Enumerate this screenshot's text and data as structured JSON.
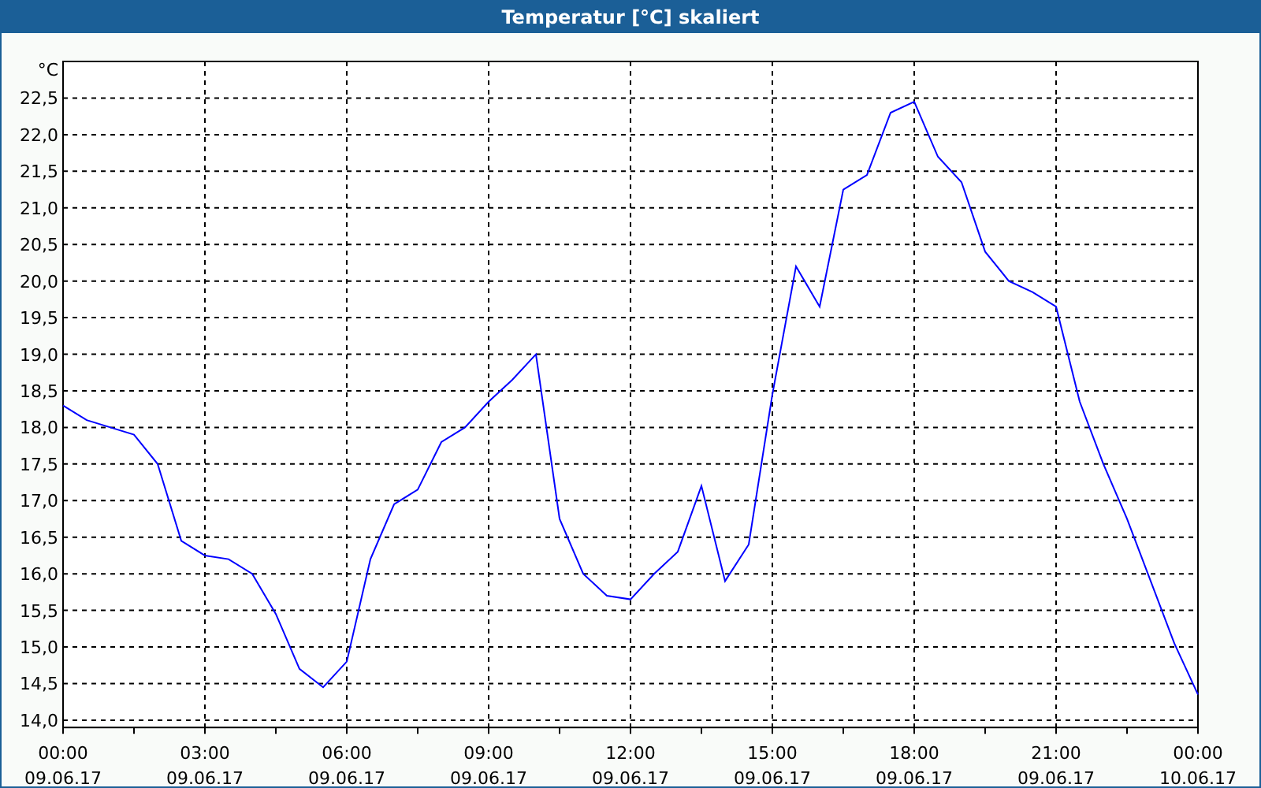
{
  "window": {
    "title": "Temperatur [°C] skaliert"
  },
  "chart": {
    "chart_data": {
      "type": "line",
      "grid": true,
      "ylabel": "°C",
      "ylim": [
        13.9,
        23.0
      ],
      "categories": [
        "00:00\n09.06.17",
        null,
        null,
        null,
        null,
        null,
        "03:00\n09.06.17",
        null,
        null,
        null,
        null,
        null,
        "06:00\n09.06.17",
        null,
        null,
        null,
        null,
        null,
        "09:00\n09.06.17",
        null,
        null,
        null,
        null,
        null,
        "12:00\n09.06.17",
        null,
        null,
        null,
        null,
        null,
        "15:00\n09.06.17",
        null,
        null,
        null,
        null,
        null,
        "18:00\n09.06.17",
        null,
        null,
        null,
        null,
        null,
        "21:00\n09.06.17",
        null,
        null,
        null,
        null,
        null,
        "00:00\n10.06.17"
      ],
      "yticks": [
        {
          "value": 14.0,
          "label": "14,0"
        },
        {
          "value": 14.5,
          "label": "14,5"
        },
        {
          "value": 15.0,
          "label": "15,0"
        },
        {
          "value": 15.5,
          "label": "15,5"
        },
        {
          "value": 16.0,
          "label": "16,0"
        },
        {
          "value": 16.5,
          "label": "16,5"
        },
        {
          "value": 17.0,
          "label": "17,0"
        },
        {
          "value": 17.5,
          "label": "17,5"
        },
        {
          "value": 18.0,
          "label": "18,0"
        },
        {
          "value": 18.5,
          "label": "18,5"
        },
        {
          "value": 19.0,
          "label": "19,0"
        },
        {
          "value": 19.5,
          "label": "19,5"
        },
        {
          "value": 20.0,
          "label": "20,0"
        },
        {
          "value": 20.5,
          "label": "20,5"
        },
        {
          "value": 21.0,
          "label": "21,0"
        },
        {
          "value": 21.5,
          "label": "21,5"
        },
        {
          "value": 22.0,
          "label": "22,0"
        },
        {
          "value": 22.5,
          "label": "22,5"
        }
      ],
      "series": [
        {
          "color": "#0000ff",
          "values": [
            18.3,
            18.1,
            18.0,
            17.9,
            17.5,
            16.45,
            16.25,
            16.2,
            16.0,
            15.45,
            14.7,
            14.45,
            14.8,
            16.2,
            16.95,
            17.15,
            17.8,
            18.0,
            18.35,
            18.65,
            19.0,
            16.75,
            16.0,
            15.7,
            15.65,
            16.0,
            16.3,
            17.2,
            15.9,
            16.4,
            18.45,
            20.2,
            19.65,
            21.25,
            21.45,
            22.3,
            22.45,
            21.7,
            21.35,
            20.4,
            20.0,
            19.85,
            19.65,
            18.35,
            17.5,
            16.75,
            15.9,
            15.05,
            14.35
          ]
        }
      ]
    }
  }
}
